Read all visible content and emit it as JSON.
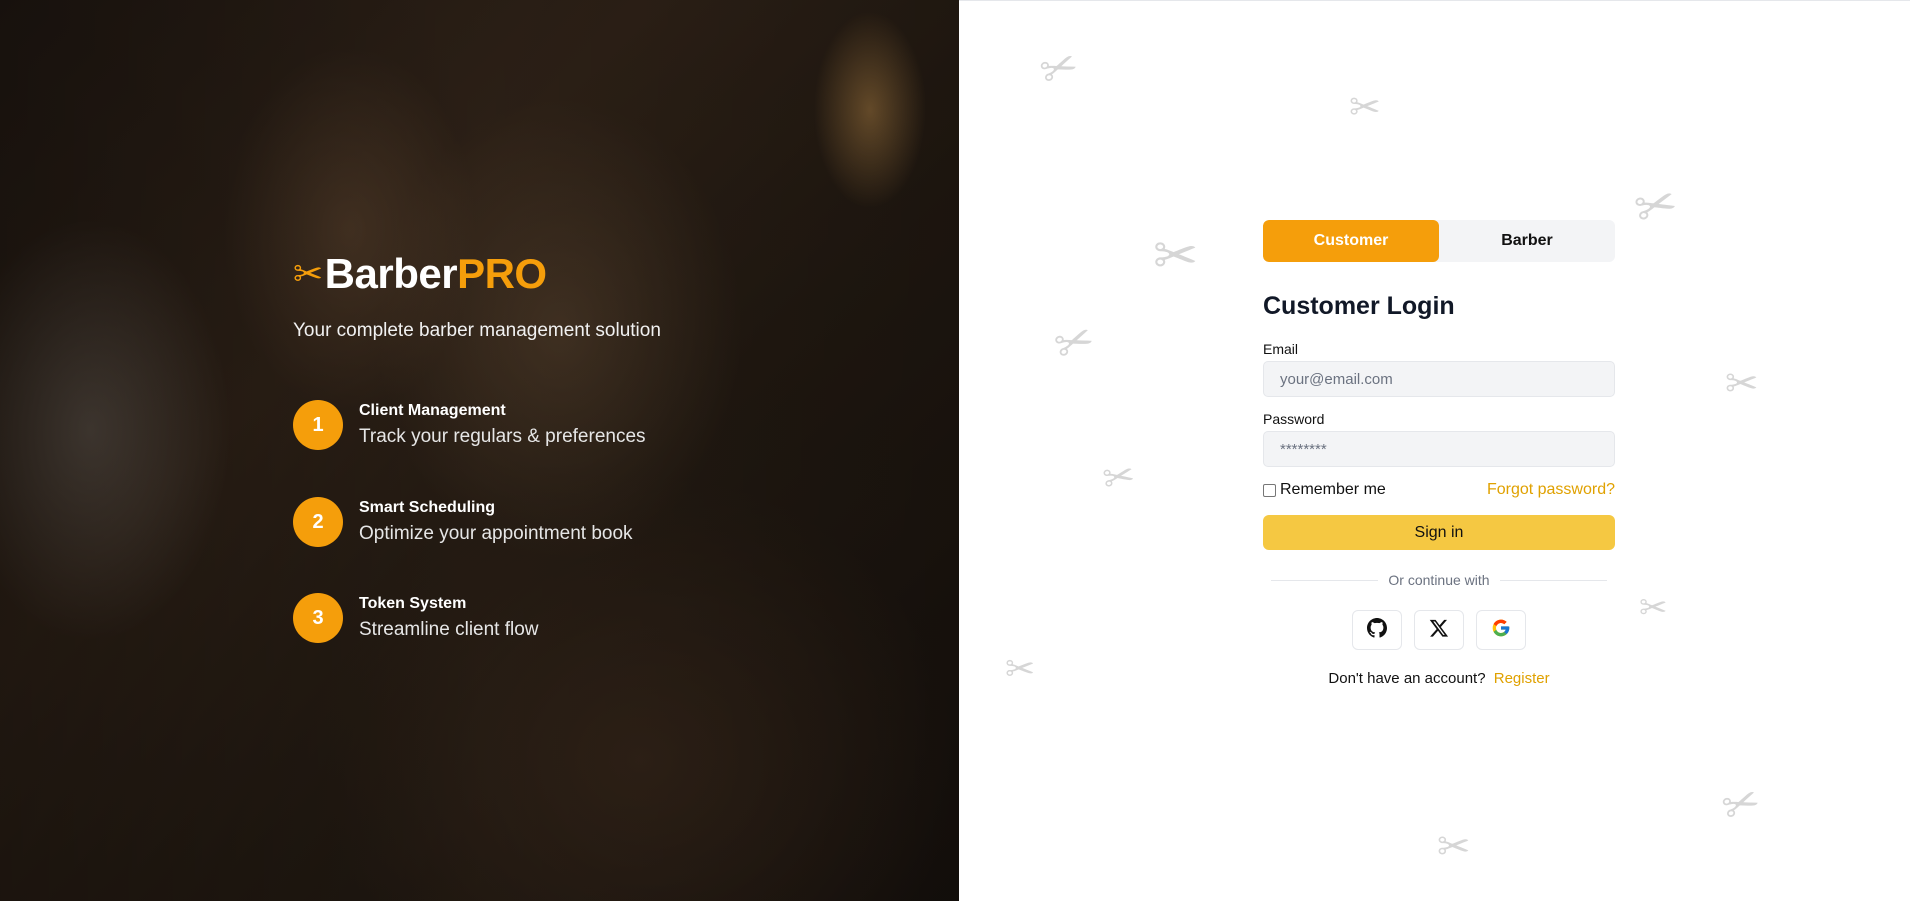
{
  "brand": {
    "name_part1": "Barber",
    "name_part2": "PRO",
    "logo_icon": "scissors-icon",
    "accent_color": "#f59e0b",
    "tagline": "Your complete barber management solution"
  },
  "features": [
    {
      "number": "1",
      "title": "Client Management",
      "description": "Track your regulars & preferences"
    },
    {
      "number": "2",
      "title": "Smart Scheduling",
      "description": "Optimize your appointment book"
    },
    {
      "number": "3",
      "title": "Token System",
      "description": "Streamline client flow"
    }
  ],
  "login": {
    "roles": [
      {
        "label": "Customer",
        "active": true
      },
      {
        "label": "Barber",
        "active": false
      }
    ],
    "title": "Customer Login",
    "email_label": "Email",
    "email_placeholder": "your@email.com",
    "password_label": "Password",
    "password_placeholder": "********",
    "remember_label": "Remember me",
    "forgot_label": "Forgot password?",
    "signin_label": "Sign in",
    "divider_text": "Or continue with",
    "social_buttons": [
      "github-icon",
      "x-icon",
      "google-icon"
    ],
    "no_account_text": "Don't have an account?",
    "register_label": "Register"
  }
}
